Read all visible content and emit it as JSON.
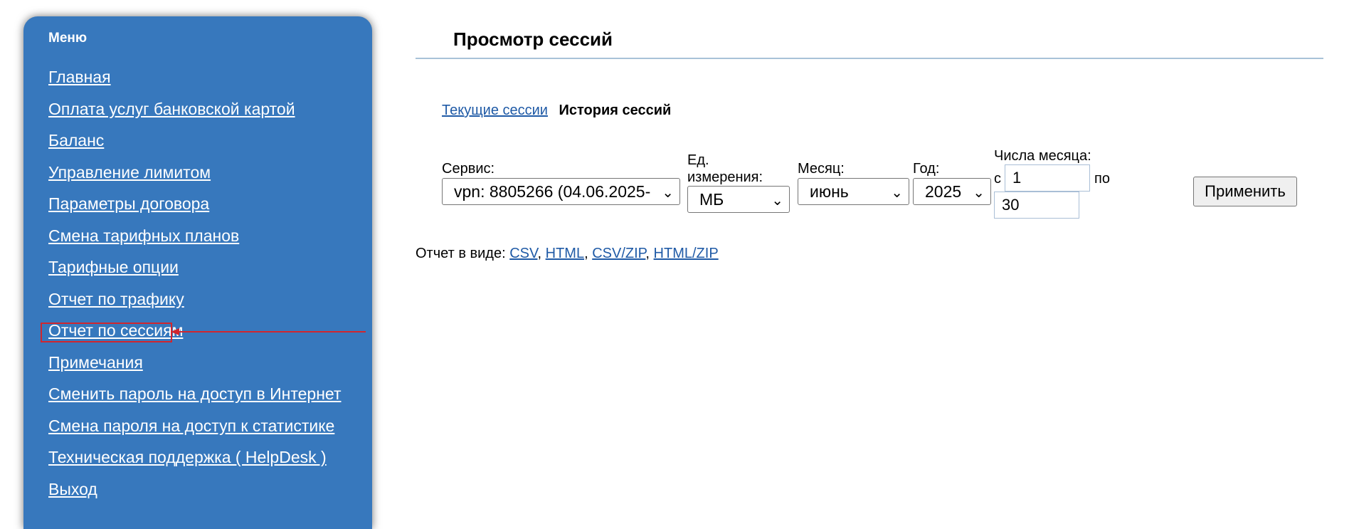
{
  "sidebar": {
    "title": "Меню",
    "items": [
      {
        "label": "Главная"
      },
      {
        "label": "Оплата услуг банковской картой"
      },
      {
        "label": "Баланс"
      },
      {
        "label": "Управление лимитом"
      },
      {
        "label": "Параметры договора"
      },
      {
        "label": "Смена тарифных планов"
      },
      {
        "label": "Тарифные опции"
      },
      {
        "label": "Отчет по трафику"
      },
      {
        "label": "Отчет по сессиям"
      },
      {
        "label": "Примечания"
      },
      {
        "label": "Сменить пароль на доступ в Интернет"
      },
      {
        "label": "Смена пароля на доступ к статистике"
      },
      {
        "label": "Техническая поддержка ( HelpDesk )"
      },
      {
        "label": "Выход"
      }
    ],
    "highlight_color": "#d0262e"
  },
  "main": {
    "title": "Просмотр сессий",
    "tabs": {
      "current": "Текущие сессии",
      "history": "История сессий"
    },
    "filters": {
      "service_label": "Сервис:",
      "service_value": "vpn: 8805266 (04.06.2025-",
      "unit_label_line1": "Ед.",
      "unit_label_line2": "измерения:",
      "unit_value": "МБ",
      "month_label": "Месяц:",
      "month_value": "июнь",
      "year_label": "Год:",
      "year_value": "2025",
      "days_label": "Числа месяца:",
      "from_label": "с",
      "from_value": "1",
      "to_label": "по",
      "to_value": "30"
    },
    "apply_button": "Применить",
    "report": {
      "label": "Отчет в виде:",
      "formats": [
        "CSV",
        "HTML",
        "CSV/ZIP",
        "HTML/ZIP"
      ]
    }
  },
  "colors": {
    "sidebar_bg": "#3778bd",
    "link": "#1f5aa6"
  }
}
